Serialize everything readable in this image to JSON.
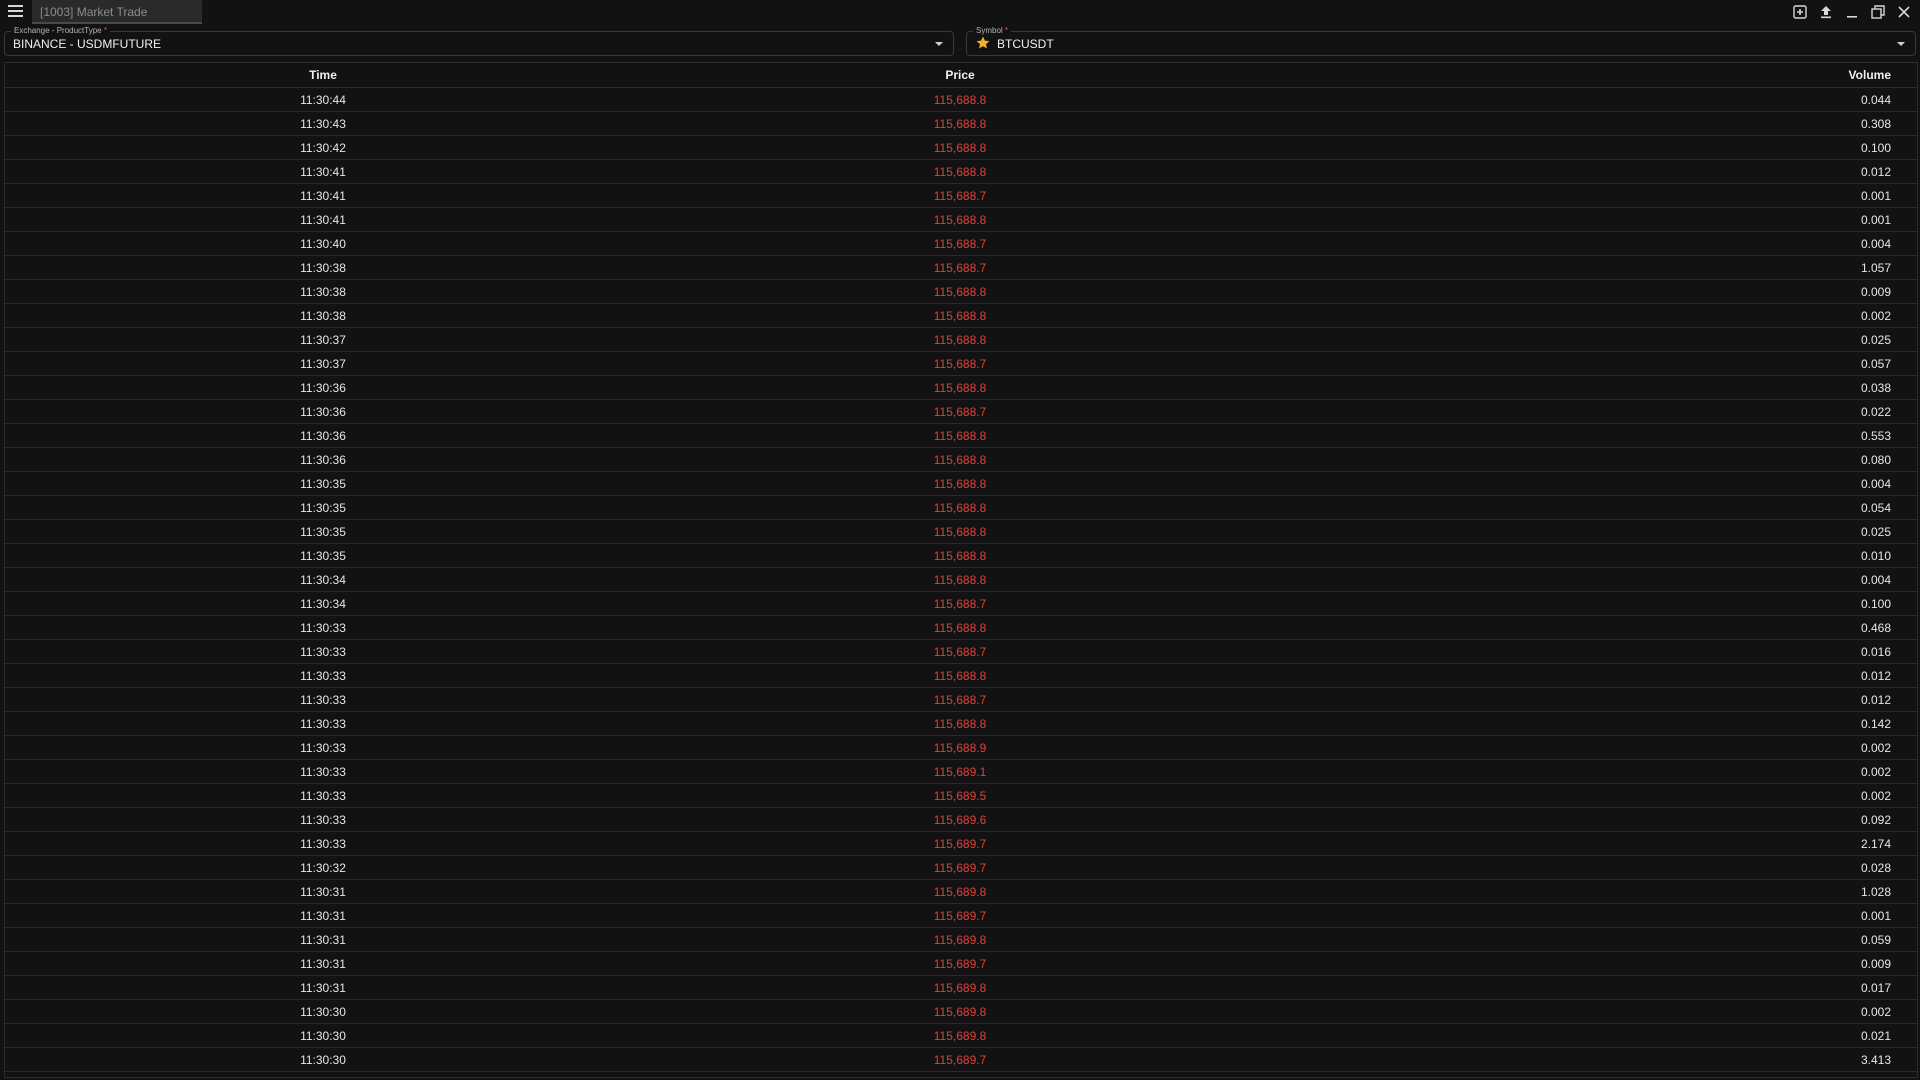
{
  "window": {
    "tab_title": "[1003] Market Trade"
  },
  "icons": {
    "menu": "hamburger-menu-icon",
    "add_window": "add-window-icon",
    "export": "upload-icon",
    "minimize": "minimize-icon",
    "restore": "restore-icon",
    "close": "close-icon",
    "favorite": "star-icon",
    "dropdown": "chevron-down-icon"
  },
  "colors": {
    "price_down": "#e0403a",
    "star": "#f0b429",
    "background": "#121212"
  },
  "exchange_field": {
    "label": "Exchange - ProductType",
    "required_mark": "*",
    "value": "BINANCE - USDMFUTURE"
  },
  "symbol_field": {
    "label": "Symbol",
    "required_mark": "*",
    "value": "BTCUSDT"
  },
  "table": {
    "headers": {
      "time": "Time",
      "price": "Price",
      "volume": "Volume"
    },
    "rows": [
      {
        "time": "11:30:44",
        "price": "115,688.8",
        "volume": "0.044"
      },
      {
        "time": "11:30:43",
        "price": "115,688.8",
        "volume": "0.308"
      },
      {
        "time": "11:30:42",
        "price": "115,688.8",
        "volume": "0.100"
      },
      {
        "time": "11:30:41",
        "price": "115,688.8",
        "volume": "0.012"
      },
      {
        "time": "11:30:41",
        "price": "115,688.7",
        "volume": "0.001"
      },
      {
        "time": "11:30:41",
        "price": "115,688.8",
        "volume": "0.001"
      },
      {
        "time": "11:30:40",
        "price": "115,688.7",
        "volume": "0.004"
      },
      {
        "time": "11:30:38",
        "price": "115,688.7",
        "volume": "1.057"
      },
      {
        "time": "11:30:38",
        "price": "115,688.8",
        "volume": "0.009"
      },
      {
        "time": "11:30:38",
        "price": "115,688.8",
        "volume": "0.002"
      },
      {
        "time": "11:30:37",
        "price": "115,688.8",
        "volume": "0.025"
      },
      {
        "time": "11:30:37",
        "price": "115,688.7",
        "volume": "0.057"
      },
      {
        "time": "11:30:36",
        "price": "115,688.8",
        "volume": "0.038"
      },
      {
        "time": "11:30:36",
        "price": "115,688.7",
        "volume": "0.022"
      },
      {
        "time": "11:30:36",
        "price": "115,688.8",
        "volume": "0.553"
      },
      {
        "time": "11:30:36",
        "price": "115,688.8",
        "volume": "0.080"
      },
      {
        "time": "11:30:35",
        "price": "115,688.8",
        "volume": "0.004"
      },
      {
        "time": "11:30:35",
        "price": "115,688.8",
        "volume": "0.054"
      },
      {
        "time": "11:30:35",
        "price": "115,688.8",
        "volume": "0.025"
      },
      {
        "time": "11:30:35",
        "price": "115,688.8",
        "volume": "0.010"
      },
      {
        "time": "11:30:34",
        "price": "115,688.8",
        "volume": "0.004"
      },
      {
        "time": "11:30:34",
        "price": "115,688.7",
        "volume": "0.100"
      },
      {
        "time": "11:30:33",
        "price": "115,688.8",
        "volume": "0.468"
      },
      {
        "time": "11:30:33",
        "price": "115,688.7",
        "volume": "0.016"
      },
      {
        "time": "11:30:33",
        "price": "115,688.8",
        "volume": "0.012"
      },
      {
        "time": "11:30:33",
        "price": "115,688.7",
        "volume": "0.012"
      },
      {
        "time": "11:30:33",
        "price": "115,688.8",
        "volume": "0.142"
      },
      {
        "time": "11:30:33",
        "price": "115,688.9",
        "volume": "0.002"
      },
      {
        "time": "11:30:33",
        "price": "115,689.1",
        "volume": "0.002"
      },
      {
        "time": "11:30:33",
        "price": "115,689.5",
        "volume": "0.002"
      },
      {
        "time": "11:30:33",
        "price": "115,689.6",
        "volume": "0.092"
      },
      {
        "time": "11:30:33",
        "price": "115,689.7",
        "volume": "2.174"
      },
      {
        "time": "11:30:32",
        "price": "115,689.7",
        "volume": "0.028"
      },
      {
        "time": "11:30:31",
        "price": "115,689.8",
        "volume": "1.028"
      },
      {
        "time": "11:30:31",
        "price": "115,689.7",
        "volume": "0.001"
      },
      {
        "time": "11:30:31",
        "price": "115,689.8",
        "volume": "0.059"
      },
      {
        "time": "11:30:31",
        "price": "115,689.7",
        "volume": "0.009"
      },
      {
        "time": "11:30:31",
        "price": "115,689.8",
        "volume": "0.017"
      },
      {
        "time": "11:30:30",
        "price": "115,689.8",
        "volume": "0.002"
      },
      {
        "time": "11:30:30",
        "price": "115,689.8",
        "volume": "0.021"
      },
      {
        "time": "11:30:30",
        "price": "115,689.7",
        "volume": "3.413"
      }
    ]
  }
}
